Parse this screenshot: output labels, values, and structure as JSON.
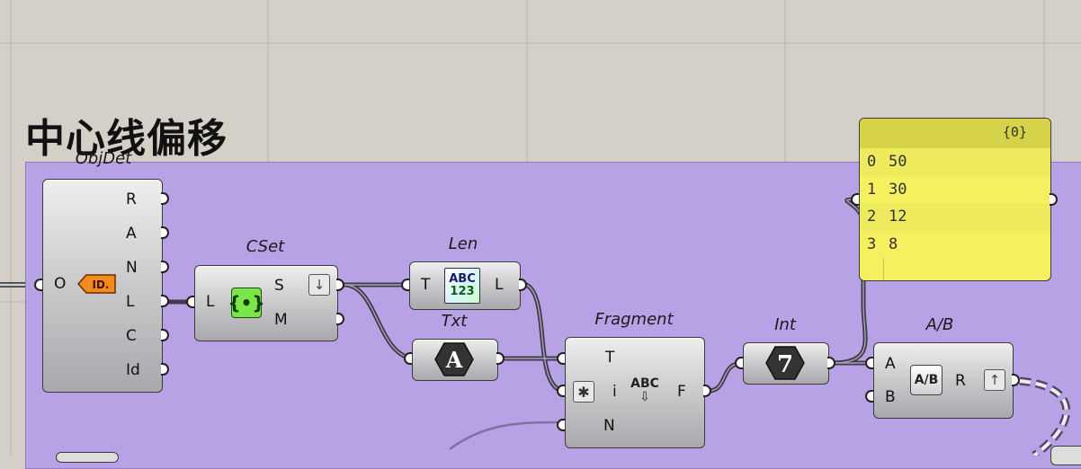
{
  "group": {
    "title": "中心线偏移"
  },
  "objdet": {
    "nickname": "ObjDet",
    "input": "O",
    "outputs": [
      "R",
      "A",
      "N",
      "L",
      "C",
      "Id"
    ],
    "icon_text": "ID."
  },
  "cset": {
    "nickname": "CSet",
    "input": "L",
    "outputs": [
      "S",
      "M"
    ],
    "icon": "set-braces-icon"
  },
  "len": {
    "nickname": "Len",
    "input": "T",
    "output": "L",
    "icon_top": "ABC",
    "icon_bottom": "123"
  },
  "txt": {
    "nickname": "Txt",
    "icon_text": "A"
  },
  "fragment": {
    "nickname": "Fragment",
    "inputs": [
      "T",
      "i",
      "N"
    ],
    "output": "F",
    "icon_text": "ABC"
  },
  "int": {
    "nickname": "Int",
    "icon_text": "7"
  },
  "ab": {
    "nickname": "A/B",
    "inputs": [
      "A",
      "B"
    ],
    "output": "R",
    "icon_text": "A/B"
  },
  "panel": {
    "path": "{0}",
    "rows": [
      {
        "index": "0",
        "value": "50"
      },
      {
        "index": "1",
        "value": "30"
      },
      {
        "index": "2",
        "value": "12"
      },
      {
        "index": "3",
        "value": "8"
      }
    ]
  },
  "colors": {
    "canvas": "#d4d0c8",
    "group": "#b8a2e6",
    "panel": "#f4f060",
    "wire": "#3f3a4f"
  }
}
